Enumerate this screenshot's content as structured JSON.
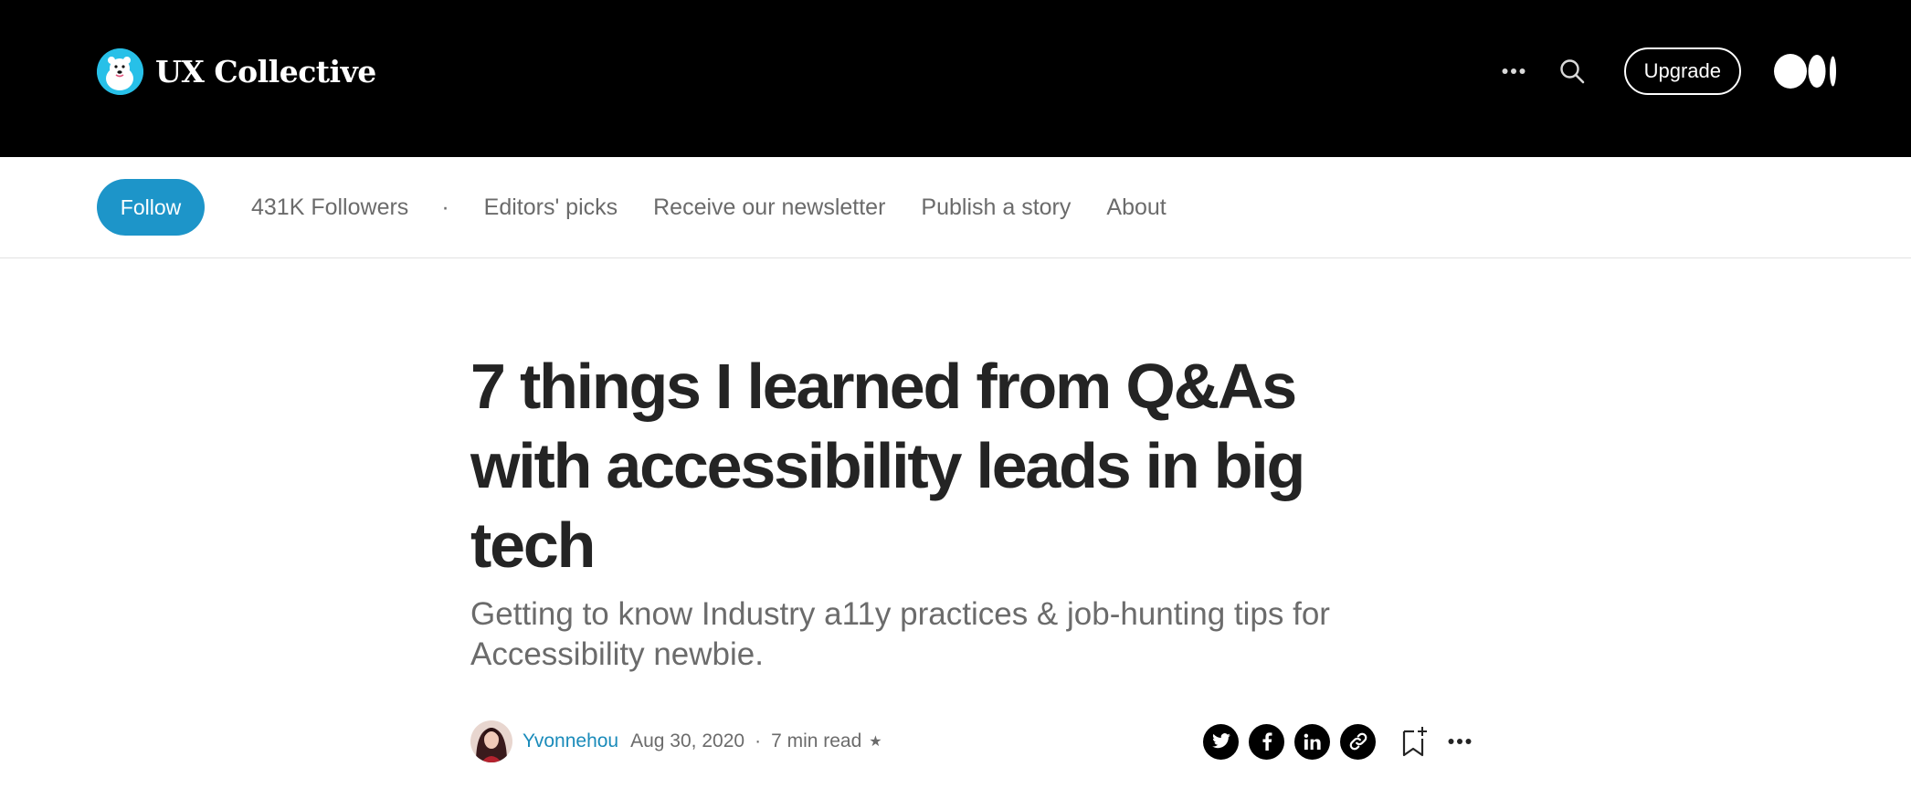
{
  "header": {
    "publication_name": "UX Collective",
    "upgrade_label": "Upgrade"
  },
  "pubnav": {
    "follow_label": "Follow",
    "followers": "431K Followers",
    "separator": "·",
    "links": [
      "Editors' picks",
      "Receive our newsletter",
      "Publish a story",
      "About"
    ]
  },
  "article": {
    "title": "7 things I learned from Q&As with accessibility leads in big tech",
    "subtitle": "Getting to know Industry a11y practices & job-hunting tips for Accessibility newbie.",
    "author": "Yvonnehou",
    "date": "Aug 30, 2020",
    "dot": "·",
    "read_time": "7 min read",
    "member_star": "★"
  },
  "icons": {
    "more": "more-horizontal-icon",
    "search": "search-icon",
    "medium_logo": "medium-logo-icon",
    "share": [
      "twitter-icon",
      "facebook-icon",
      "linkedin-icon",
      "link-icon"
    ],
    "bookmark": "bookmark-add-icon",
    "article_more": "more-horizontal-icon"
  },
  "colors": {
    "topbar_bg": "#000000",
    "follow_bg": "#1d95c9",
    "author_link": "#1a8bba",
    "title": "#242424",
    "muted": "#6b6b6b"
  }
}
